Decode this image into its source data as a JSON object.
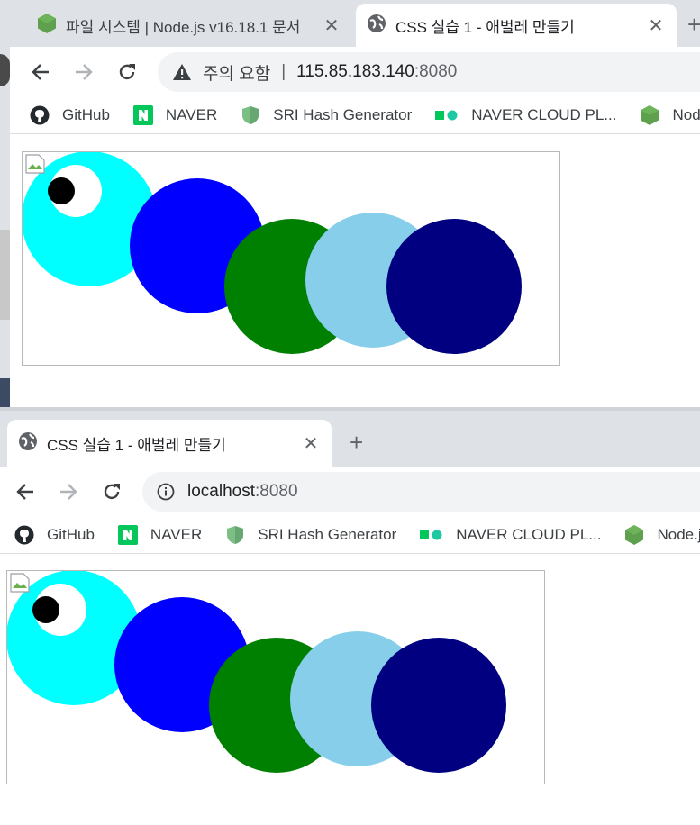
{
  "window1": {
    "tabs": [
      {
        "title": "파일 시스템 | Node.js v16.18.1 문서",
        "icon": "nodejs-icon",
        "active": false
      },
      {
        "title": "CSS 실습 1 - 애벌레 만들기",
        "icon": "globe-icon",
        "active": true
      }
    ],
    "security": "주의 요함",
    "host": "115.85.183.140",
    "port": ":8080"
  },
  "window2": {
    "tabs": [
      {
        "title": "CSS 실습 1 - 애벌레 만들기",
        "icon": "globe-icon",
        "active": true
      }
    ],
    "host": "localhost",
    "port": ":8080"
  },
  "bookmarks": [
    {
      "label": "GitHub",
      "icon": "github-icon"
    },
    {
      "label": "NAVER",
      "icon": "naver-icon"
    },
    {
      "label": "SRI Hash Generator",
      "icon": "shield-icon"
    },
    {
      "label": "NAVER CLOUD PL...",
      "icon": "naver-cloud-icon"
    },
    {
      "label": "Node.js",
      "icon": "nodejs-icon"
    }
  ],
  "caterpillar": {
    "segments": [
      "#00ffff",
      "#0000ff",
      "#008000",
      "#87ceeb",
      "#000080"
    ],
    "eye": "#ffffff",
    "pupil": "#000000"
  }
}
